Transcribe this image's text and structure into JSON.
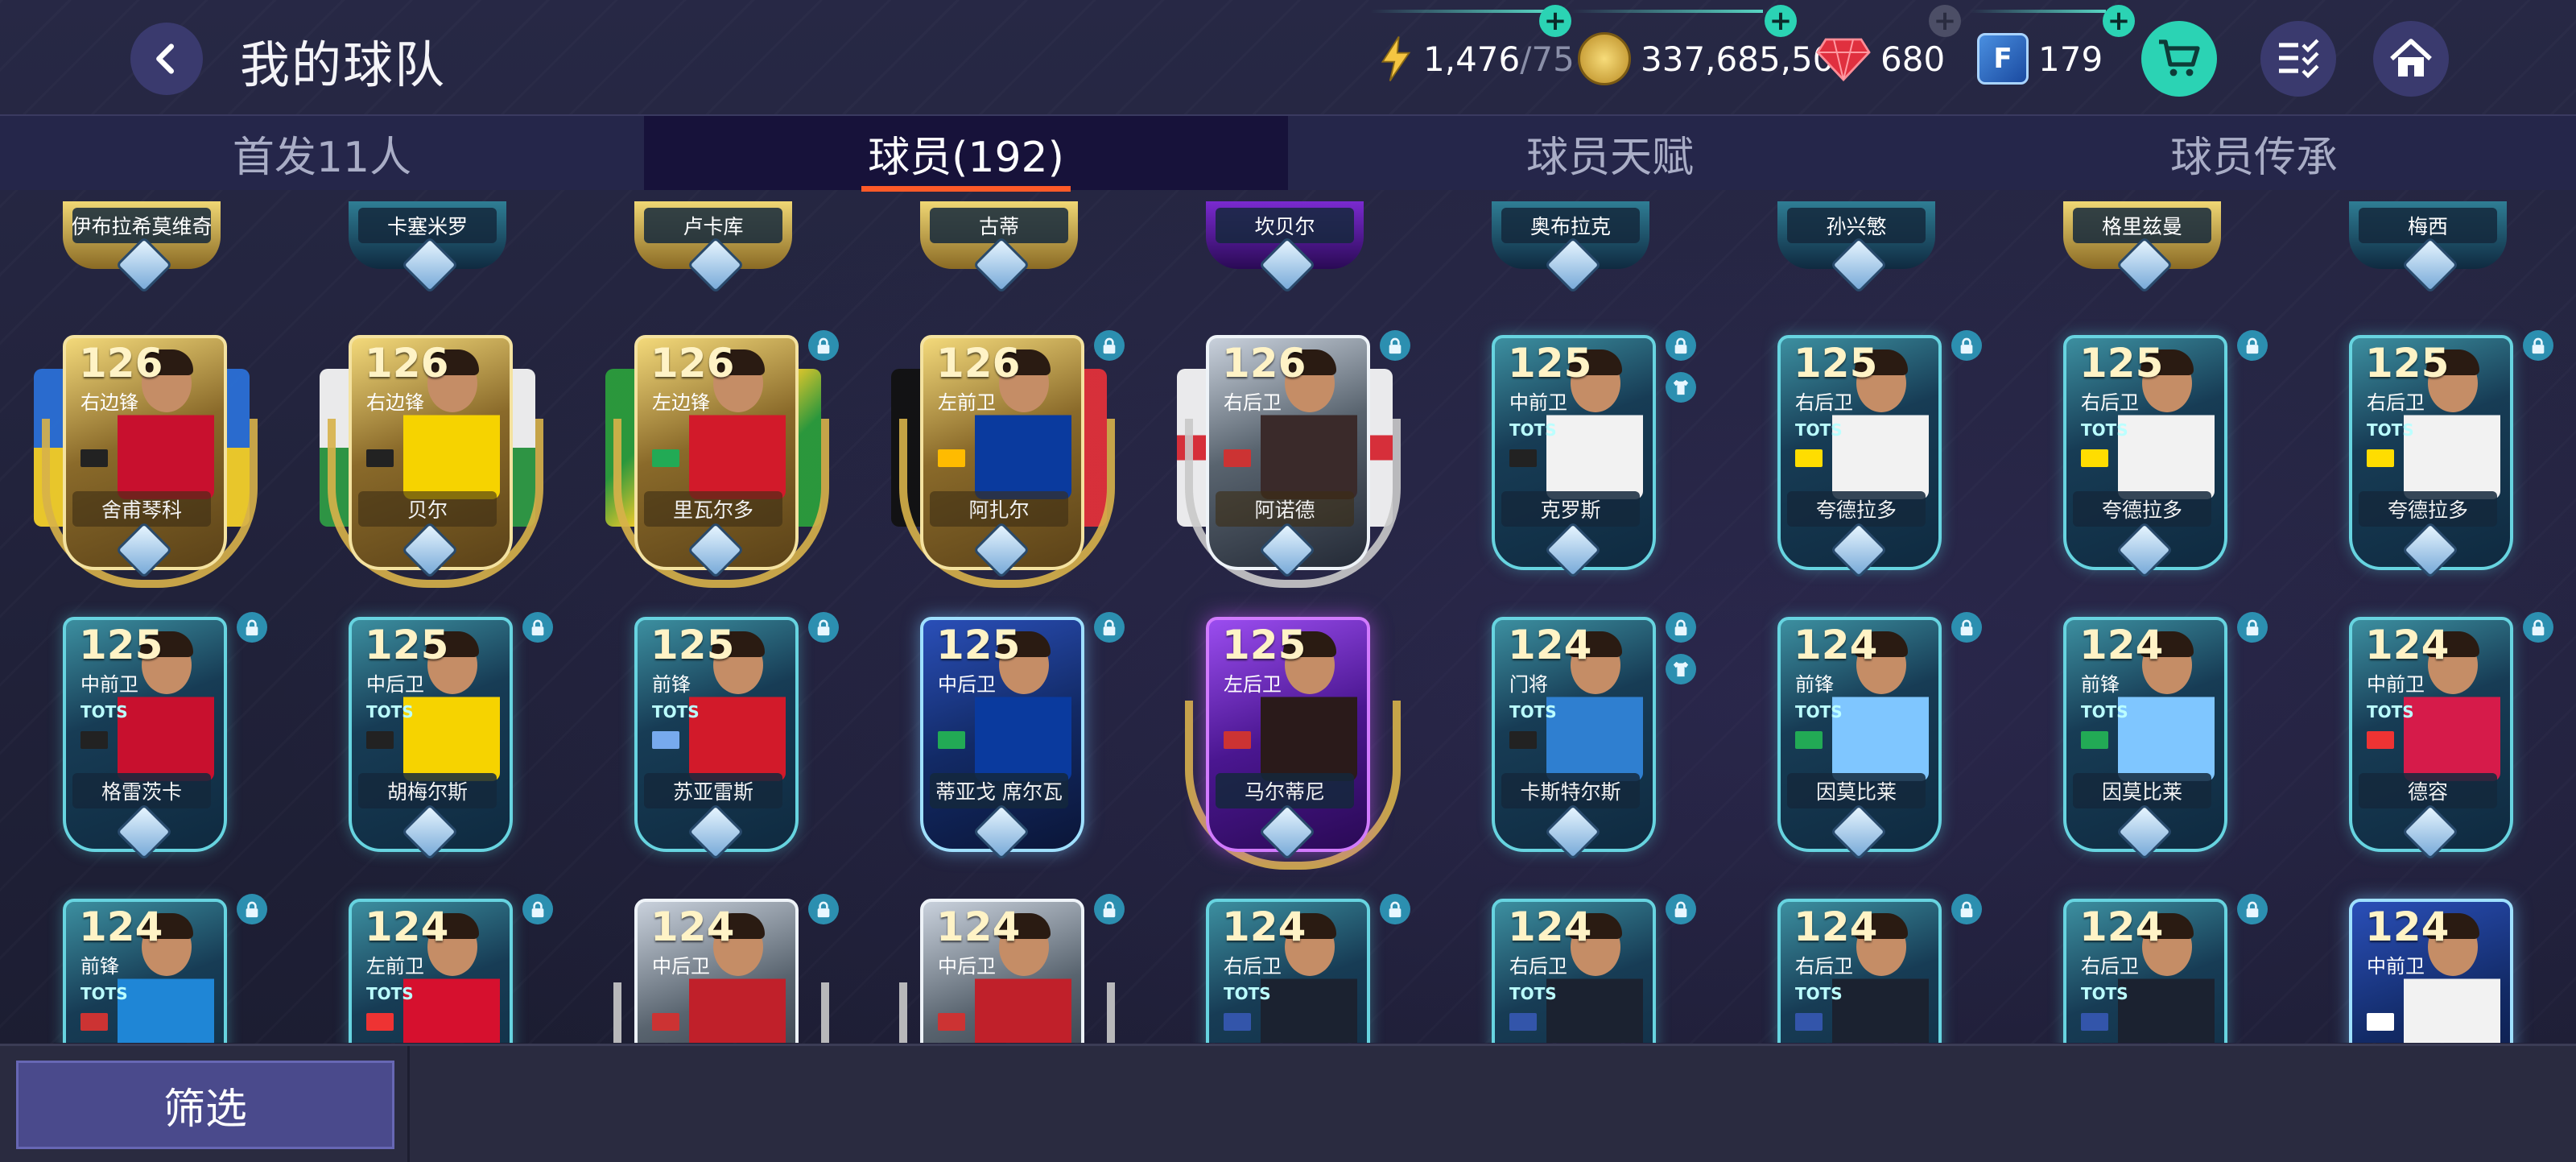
{
  "header": {
    "title": "我的球队",
    "energy": {
      "value": "1,476",
      "max": "/75"
    },
    "coins": "337,685,507",
    "gems": "680",
    "fifa_points": "179",
    "plus_label": "+"
  },
  "tabs": [
    {
      "label": "首发11人",
      "active": false
    },
    {
      "label": "球员(192)",
      "active": true
    },
    {
      "label": "球员天赋",
      "active": false
    },
    {
      "label": "球员传承",
      "active": false
    }
  ],
  "top_row": [
    {
      "name": "伊布拉希莫维奇",
      "style": "gold"
    },
    {
      "name": "卡塞米罗",
      "style": "teal"
    },
    {
      "name": "卢卡库",
      "style": "gold"
    },
    {
      "name": "古蒂",
      "style": "gold"
    },
    {
      "name": "坎贝尔",
      "style": "purple"
    },
    {
      "name": "奥布拉克",
      "style": "teal"
    },
    {
      "name": "孙兴慜",
      "style": "teal"
    },
    {
      "name": "格里兹曼",
      "style": "gold"
    },
    {
      "name": "梅西",
      "style": "teal"
    }
  ],
  "cards": [
    {
      "rating": "126",
      "pos": "右边锋",
      "name": "舍甫琴科",
      "style": "gold",
      "flag": "ukraine",
      "tots": "",
      "lock": false
    },
    {
      "rating": "126",
      "pos": "右边锋",
      "name": "贝尔",
      "style": "gold",
      "flag": "wales",
      "tots": "",
      "lock": false
    },
    {
      "rating": "126",
      "pos": "左边锋",
      "name": "里瓦尔多",
      "style": "gold",
      "flag": "brazil",
      "tots": "",
      "lock": true
    },
    {
      "rating": "126",
      "pos": "左前卫",
      "name": "阿扎尔",
      "style": "gold",
      "flag": "belgium",
      "tots": "",
      "lock": true
    },
    {
      "rating": "126",
      "pos": "右后卫",
      "name": "阿诺德",
      "style": "silver",
      "flag": "england",
      "tots": "",
      "lock": true
    },
    {
      "rating": "125",
      "pos": "中前卫",
      "name": "克罗斯",
      "style": "teal",
      "flag": "",
      "tots": "TOTS",
      "lock": true,
      "shirt": true
    },
    {
      "rating": "125",
      "pos": "右后卫",
      "name": "夸德拉多",
      "style": "teal",
      "flag": "",
      "tots": "TOTS",
      "lock": true
    },
    {
      "rating": "125",
      "pos": "右后卫",
      "name": "夸德拉多",
      "style": "teal",
      "flag": "",
      "tots": "TOTS",
      "lock": true
    },
    {
      "rating": "125",
      "pos": "右后卫",
      "name": "夸德拉多",
      "style": "teal",
      "flag": "",
      "tots": "TOTS",
      "lock": true
    },
    {
      "rating": "125",
      "pos": "中前卫",
      "name": "格雷茨卡",
      "style": "teal",
      "flag": "",
      "tots": "TOTS",
      "lock": true
    },
    {
      "rating": "125",
      "pos": "中后卫",
      "name": "胡梅尔斯",
      "style": "teal",
      "flag": "",
      "tots": "TOTS",
      "lock": true
    },
    {
      "rating": "125",
      "pos": "前锋",
      "name": "苏亚雷斯",
      "style": "teal",
      "flag": "",
      "tots": "TOTS",
      "lock": true
    },
    {
      "rating": "125",
      "pos": "中后卫",
      "name": "蒂亚戈 席尔瓦",
      "style": "blue",
      "flag": "",
      "tots": "",
      "lock": true
    },
    {
      "rating": "125",
      "pos": "左后卫",
      "name": "马尔蒂尼",
      "style": "purple",
      "flag": "",
      "tots": "",
      "lock": false
    },
    {
      "rating": "124",
      "pos": "门将",
      "name": "卡斯特尔斯",
      "style": "teal",
      "flag": "",
      "tots": "TOTS",
      "lock": true,
      "shirt": true
    },
    {
      "rating": "124",
      "pos": "前锋",
      "name": "因莫比莱",
      "style": "teal",
      "flag": "",
      "tots": "TOTS",
      "lock": true
    },
    {
      "rating": "124",
      "pos": "前锋",
      "name": "因莫比莱",
      "style": "teal",
      "flag": "",
      "tots": "TOTS",
      "lock": true
    },
    {
      "rating": "124",
      "pos": "中前卫",
      "name": "德容",
      "style": "teal",
      "flag": "",
      "tots": "TOTS",
      "lock": true
    },
    {
      "rating": "124",
      "pos": "前锋",
      "name": "",
      "style": "teal",
      "flag": "",
      "tots": "TOTS",
      "lock": true
    },
    {
      "rating": "124",
      "pos": "左前卫",
      "name": "",
      "style": "teal",
      "flag": "",
      "tots": "TOTS",
      "lock": true
    },
    {
      "rating": "124",
      "pos": "中后卫",
      "name": "",
      "style": "silver",
      "flag": "",
      "tots": "",
      "lock": true
    },
    {
      "rating": "124",
      "pos": "中后卫",
      "name": "",
      "style": "silver",
      "flag": "",
      "tots": "",
      "lock": true
    },
    {
      "rating": "124",
      "pos": "右后卫",
      "name": "",
      "style": "teal",
      "flag": "",
      "tots": "TOTS",
      "lock": true
    },
    {
      "rating": "124",
      "pos": "右后卫",
      "name": "",
      "style": "teal",
      "flag": "",
      "tots": "TOTS",
      "lock": true
    },
    {
      "rating": "124",
      "pos": "右后卫",
      "name": "",
      "style": "teal",
      "flag": "",
      "tots": "TOTS",
      "lock": true
    },
    {
      "rating": "124",
      "pos": "右后卫",
      "name": "",
      "style": "teal",
      "flag": "",
      "tots": "TOTS",
      "lock": true
    },
    {
      "rating": "124",
      "pos": "中前卫",
      "name": "",
      "style": "blue",
      "flag": "",
      "tots": "",
      "lock": false
    }
  ],
  "bottom": {
    "filter_label": "筛选"
  },
  "colors": {
    "accent": "#2bd3b4",
    "tab_underline": "#ff5a28",
    "background": "#1d1f35"
  },
  "icons": {
    "back": "chevron-left-icon",
    "energy": "lightning-icon",
    "coin": "fifa-coin-icon",
    "gem": "gem-icon",
    "fp": "fifa-points-icon",
    "store": "cart-icon",
    "list": "checklist-icon",
    "home": "home-icon",
    "lock": "lock-icon"
  }
}
